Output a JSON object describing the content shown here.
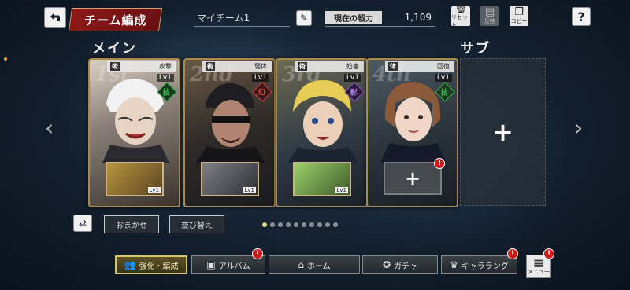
{
  "header": {
    "back_icon": "back-arrow-icon",
    "title": "チーム編成",
    "team_name": "マイチーム1",
    "power_label": "現在の戦力",
    "power_value": "1,109",
    "reset_label": "リセット",
    "reflect_label": "反映",
    "copy_label": "コピー"
  },
  "sections": {
    "main": "メイン",
    "sub": "サブ"
  },
  "cards": [
    {
      "ordinal": "1st",
      "type_tag": "術",
      "role": "攻撃",
      "level": "Lv1",
      "attr": "技",
      "attr_color": "#3dbb55",
      "sub_level": "Lv1",
      "has_sub": true
    },
    {
      "ordinal": "2nd",
      "type_tag": "術",
      "role": "弱体",
      "level": "Lv1",
      "attr": "幻",
      "attr_color": "#e04545",
      "sub_level": "Lv1",
      "has_sub": true
    },
    {
      "ordinal": "3rd",
      "type_tag": "術",
      "role": "妨害",
      "level": "Lv1",
      "attr": "影",
      "attr_color": "#9a5ad0",
      "sub_level": "Lv1",
      "has_sub": true
    },
    {
      "ordinal": "4th",
      "type_tag": "体",
      "role": "回復",
      "level": "Lv1",
      "attr": "技",
      "attr_color": "#3dbb55",
      "has_sub": false
    }
  ],
  "buttons": {
    "auto": "おまかせ",
    "sort": "並び替え"
  },
  "pagination": {
    "total": 10,
    "active": 0
  },
  "nav": [
    {
      "label": "強化・編成",
      "active": true,
      "badge": false
    },
    {
      "label": "アルバム",
      "active": false,
      "badge": true
    },
    {
      "label": "ホーム",
      "active": false,
      "badge": false
    },
    {
      "label": "ガチャ",
      "active": false,
      "badge": false
    },
    {
      "label": "キャララング",
      "active": false,
      "badge": true
    }
  ],
  "menu_label": "メニュー",
  "colors": {
    "accent_gold": "#d9c46a",
    "banner_red": "#8e1919",
    "badge_red": "#d01a1a"
  }
}
